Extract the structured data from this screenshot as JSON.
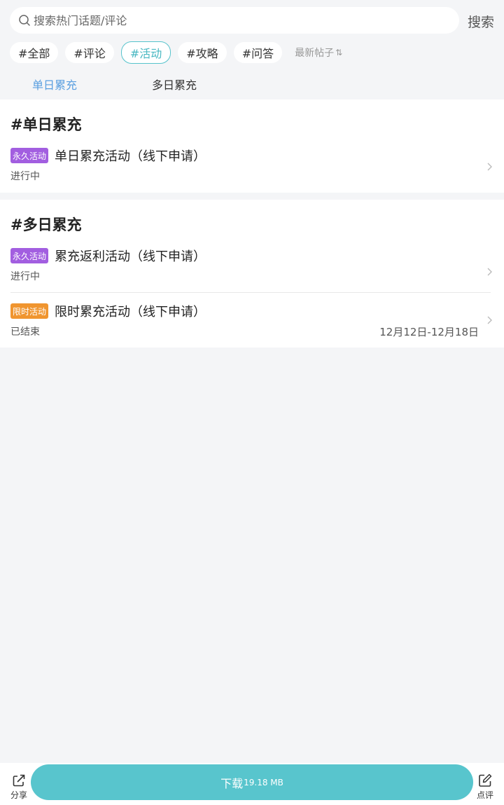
{
  "search": {
    "placeholder": "搜索热门话题/评论",
    "button": "搜索"
  },
  "tags": [
    "#全部",
    "#评论",
    "#活动",
    "#攻略",
    "#问答"
  ],
  "active_tag": "#活动",
  "sort": {
    "label": "最新帖子",
    "icon": "sort-arrows-icon"
  },
  "subtabs": [
    "单日累充",
    "多日累充"
  ],
  "sections": [
    {
      "title": "#单日累充",
      "items": [
        {
          "badge": "永久活动",
          "badge_color": "#a25ee0",
          "title": "单日累充活动（线下申请）",
          "status": "进行中"
        }
      ]
    },
    {
      "title": "#多日累充",
      "items": [
        {
          "badge": "永久活动",
          "badge_color": "#a25ee0",
          "title": "累充返利活动（线下申请）",
          "status": "进行中"
        },
        {
          "badge": "限时活动",
          "badge_color": "#f0952f",
          "title": "限时累充活动（线下申请）",
          "status": "已结束",
          "date": "12月12日-12月18日"
        }
      ]
    }
  ],
  "bottom": {
    "share_label": "分享",
    "download_label": "下载",
    "download_size": "19.18 MB",
    "review_label": "点评",
    "accent": "#58c5cd"
  }
}
